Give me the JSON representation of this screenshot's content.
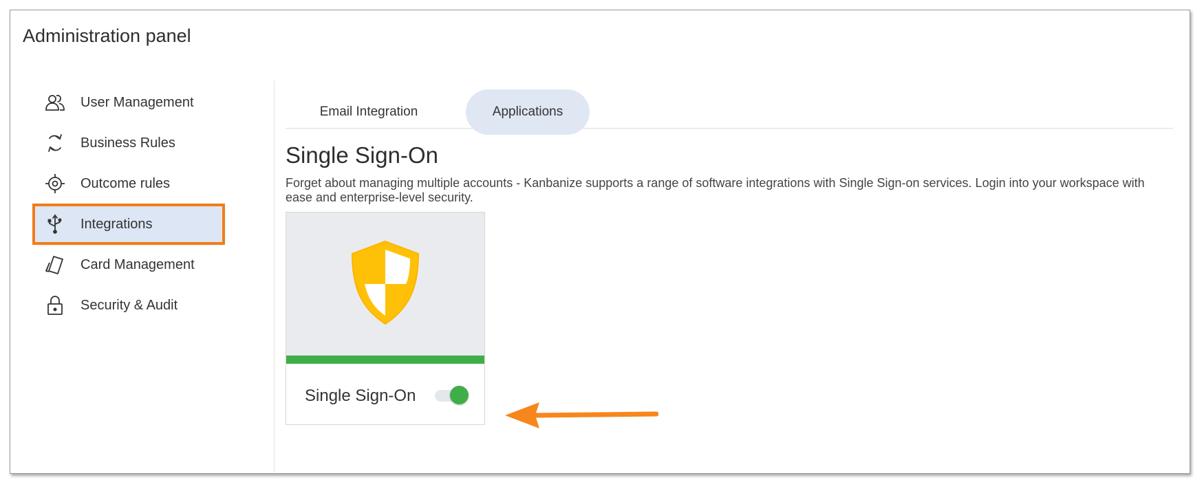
{
  "page": {
    "title": "Administration panel"
  },
  "sidebar": {
    "items": [
      {
        "label": "User Management",
        "icon": "users-icon"
      },
      {
        "label": "Business Rules",
        "icon": "refresh-cycle-icon"
      },
      {
        "label": "Outcome rules",
        "icon": "target-icon"
      },
      {
        "label": "Integrations",
        "icon": "usb-icon",
        "active": true
      },
      {
        "label": "Card Management",
        "icon": "card-tilt-icon"
      },
      {
        "label": "Security & Audit",
        "icon": "lock-icon"
      }
    ]
  },
  "tabs": [
    {
      "label": "Email Integration",
      "selected": false
    },
    {
      "label": "Applications",
      "selected": true
    }
  ],
  "section": {
    "title": "Single Sign-On",
    "description": "Forget about managing multiple accounts - Kanbanize supports a range of software integrations with Single Sign-on services. Login into your workspace with ease and enterprise-level security."
  },
  "card": {
    "name": "Single Sign-On",
    "icon": "shield-icon",
    "enabled": true
  },
  "colors": {
    "highlight_outline": "#f07d1a",
    "active_bg": "#dde6f4",
    "shield": "#ffc107",
    "status_bar": "#3fae49",
    "toggle_on": "#3fae49",
    "arrow": "#f7861c"
  }
}
